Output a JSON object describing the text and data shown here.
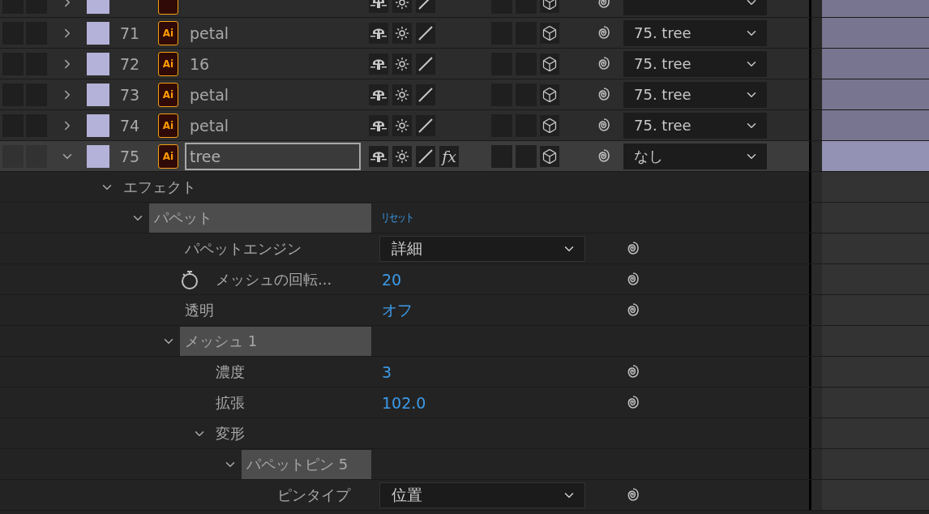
{
  "layers": [
    {
      "expanded": false,
      "selected": false,
      "editing": false
    },
    {
      "number": "71",
      "name": "petal",
      "type_badge": "Ai",
      "parent": "75. tree",
      "expanded": false,
      "selected": false,
      "editing": false
    },
    {
      "number": "72",
      "name": "16",
      "type_badge": "Ai",
      "parent": "75. tree",
      "expanded": false,
      "selected": false,
      "editing": false
    },
    {
      "number": "73",
      "name": "petal",
      "type_badge": "Ai",
      "parent": "75. tree",
      "expanded": false,
      "selected": false,
      "editing": false
    },
    {
      "number": "74",
      "name": "petal",
      "type_badge": "Ai",
      "parent": "75. tree",
      "expanded": false,
      "selected": false,
      "editing": false
    },
    {
      "number": "75",
      "name": "tree",
      "type_badge": "Ai",
      "parent": "なし",
      "expanded": true,
      "selected": true,
      "editing": true,
      "fx_label": "fx"
    }
  ],
  "properties": [
    {
      "kind": "folder",
      "label": "エフェクト",
      "expanded": true,
      "children": [
        {
          "kind": "group",
          "label": "パペット",
          "expanded": true,
          "action": "リセット",
          "children": [
            {
              "kind": "dropdown",
              "label": "パペットエンジン",
              "value": "詳細"
            },
            {
              "kind": "value",
              "label": "メッシュの回転...",
              "value": "20",
              "stopwatch": true
            },
            {
              "kind": "value",
              "label": "透明",
              "value": "オフ"
            },
            {
              "kind": "group",
              "label": "メッシュ 1",
              "expanded": true,
              "children": [
                {
                  "kind": "value",
                  "label": "濃度",
                  "value": "3"
                },
                {
                  "kind": "value",
                  "label": "拡張",
                  "value": "102.0"
                },
                {
                  "kind": "folder",
                  "label": "変形",
                  "expanded": true,
                  "children": [
                    {
                      "kind": "group",
                      "label": "パペットピン 5",
                      "expanded": true,
                      "children": [
                        {
                          "kind": "dropdown",
                          "label": "ピンタイプ",
                          "value": "位置"
                        }
                      ]
                    }
                  ]
                }
              ]
            }
          ]
        }
      ]
    }
  ]
}
